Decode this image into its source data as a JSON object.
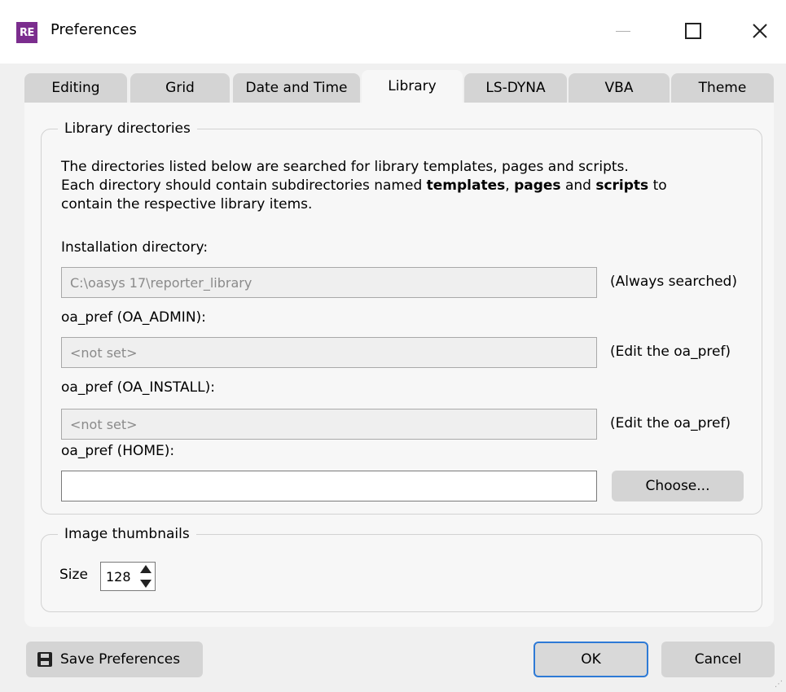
{
  "window": {
    "title": "Preferences",
    "app_icon_text": "RE",
    "controls": {
      "minimize": "minimize",
      "maximize": "maximize",
      "close": "close"
    }
  },
  "tabs": [
    {
      "label": "Editing",
      "active": false
    },
    {
      "label": "Grid",
      "active": false
    },
    {
      "label": "Date and Time",
      "active": false
    },
    {
      "label": "Library",
      "active": true
    },
    {
      "label": "LS-DYNA",
      "active": false
    },
    {
      "label": "VBA",
      "active": false
    },
    {
      "label": "Theme",
      "active": false
    }
  ],
  "library": {
    "group_title": "Library directories",
    "desc_line1": "The directories listed below are searched for library templates, pages and scripts.",
    "desc_line2_a": "Each directory should contain subdirectories named ",
    "desc_templates": "templates",
    "desc_comma": ", ",
    "desc_pages": "pages",
    "desc_and": " and ",
    "desc_scripts": "scripts",
    "desc_line2_b": " to",
    "desc_line3": "contain the respective library items.",
    "install_label": "Installation directory:",
    "install_value": "C:\\oasys 17\\reporter_library",
    "install_note": "(Always searched)",
    "admin_label": "oa_pref (OA_ADMIN):",
    "admin_value": "<not set>",
    "admin_note": "(Edit the oa_pref)",
    "install_pref_label": "oa_pref (OA_INSTALL):",
    "install_pref_value": "<not set>",
    "install_pref_note": "(Edit the oa_pref)",
    "home_label": "oa_pref (HOME):",
    "home_value": "",
    "choose_label": "Choose..."
  },
  "thumbnails": {
    "group_title": "Image thumbnails",
    "size_label": "Size",
    "size_value": "128"
  },
  "footer": {
    "save_label": "Save Preferences",
    "ok_label": "OK",
    "cancel_label": "Cancel"
  },
  "colors": {
    "app_icon": "#7b2d8e",
    "ok_focus_border": "#2e7ad6",
    "tab_inactive": "#d4d4d4",
    "panel": "#f7f7f7"
  }
}
